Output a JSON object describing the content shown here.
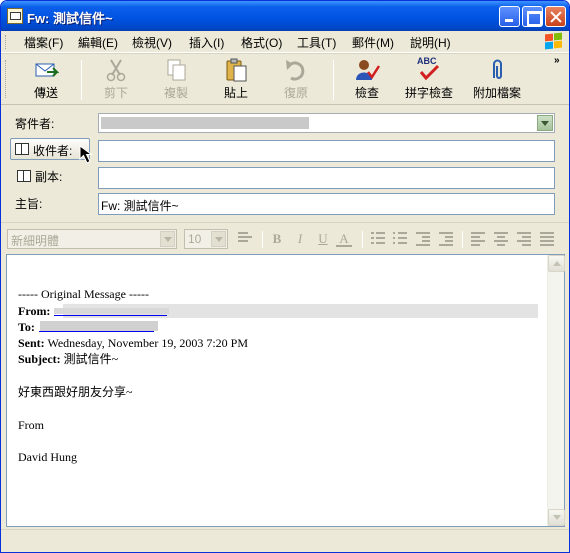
{
  "window": {
    "title": "Fw: 測試信件~"
  },
  "menu": [
    {
      "label": "檔案(F)"
    },
    {
      "label": "編輯(E)"
    },
    {
      "label": "檢視(V)"
    },
    {
      "label": "插入(I)"
    },
    {
      "label": "格式(O)"
    },
    {
      "label": "工具(T)"
    },
    {
      "label": "郵件(M)"
    },
    {
      "label": "說明(H)"
    }
  ],
  "toolbar": {
    "send": "傳送",
    "cut": "剪下",
    "copy": "複製",
    "paste": "貼上",
    "undo": "復原",
    "check": "檢查",
    "spell": "拼字檢查",
    "attach": "附加檔案",
    "more": "»",
    "spell_icon_text": "ABC"
  },
  "header": {
    "from_label": "寄件者:",
    "to_label": "收件者:",
    "cc_label": "副本:",
    "subject_label": "主旨:",
    "to_value": "",
    "cc_value": "",
    "subject_value": "Fw: 測試信件~"
  },
  "format": {
    "font": "新細明體",
    "size": "10",
    "bold": "B",
    "italic": "I",
    "underline": "U",
    "color": "A"
  },
  "message": {
    "original": "----- Original Message -----",
    "from_label": "From:",
    "to_label": "To:",
    "sent_label": "Sent:",
    "sent_value": " Wednesday, November 19, 2003 7:20 PM",
    "subject_label": "Subject:",
    "subject_value": " 測試信件~",
    "line1": "好東西跟好朋友分享~",
    "line2": "From",
    "line3": "David Hung"
  },
  "colors": {
    "titlebar": "#0054e3",
    "chrome": "#ece9d8",
    "field_border": "#7f9db9",
    "disabled": "#aca899",
    "link": "#0000ee"
  }
}
